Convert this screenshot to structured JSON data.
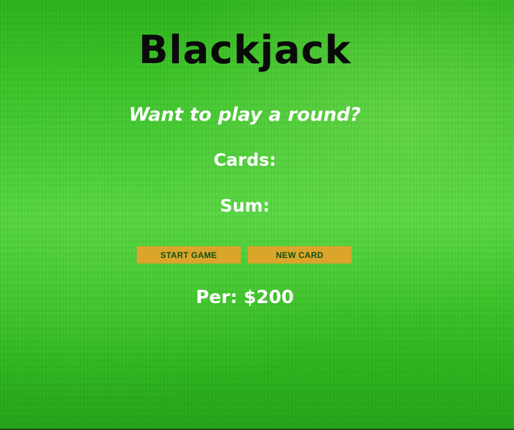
{
  "title": "Blackjack",
  "message": "Want to play a round?",
  "cards_label": "Cards:",
  "sum_label": "Sum:",
  "buttons": {
    "start": "START GAME",
    "new_card": "NEW CARD"
  },
  "player": "Per: $200",
  "colors": {
    "button_bg": "#dba42b",
    "button_text": "#0f4f12",
    "title_text": "#0a0a0a",
    "body_text": "#ffffff",
    "background": "#3ec42a"
  }
}
